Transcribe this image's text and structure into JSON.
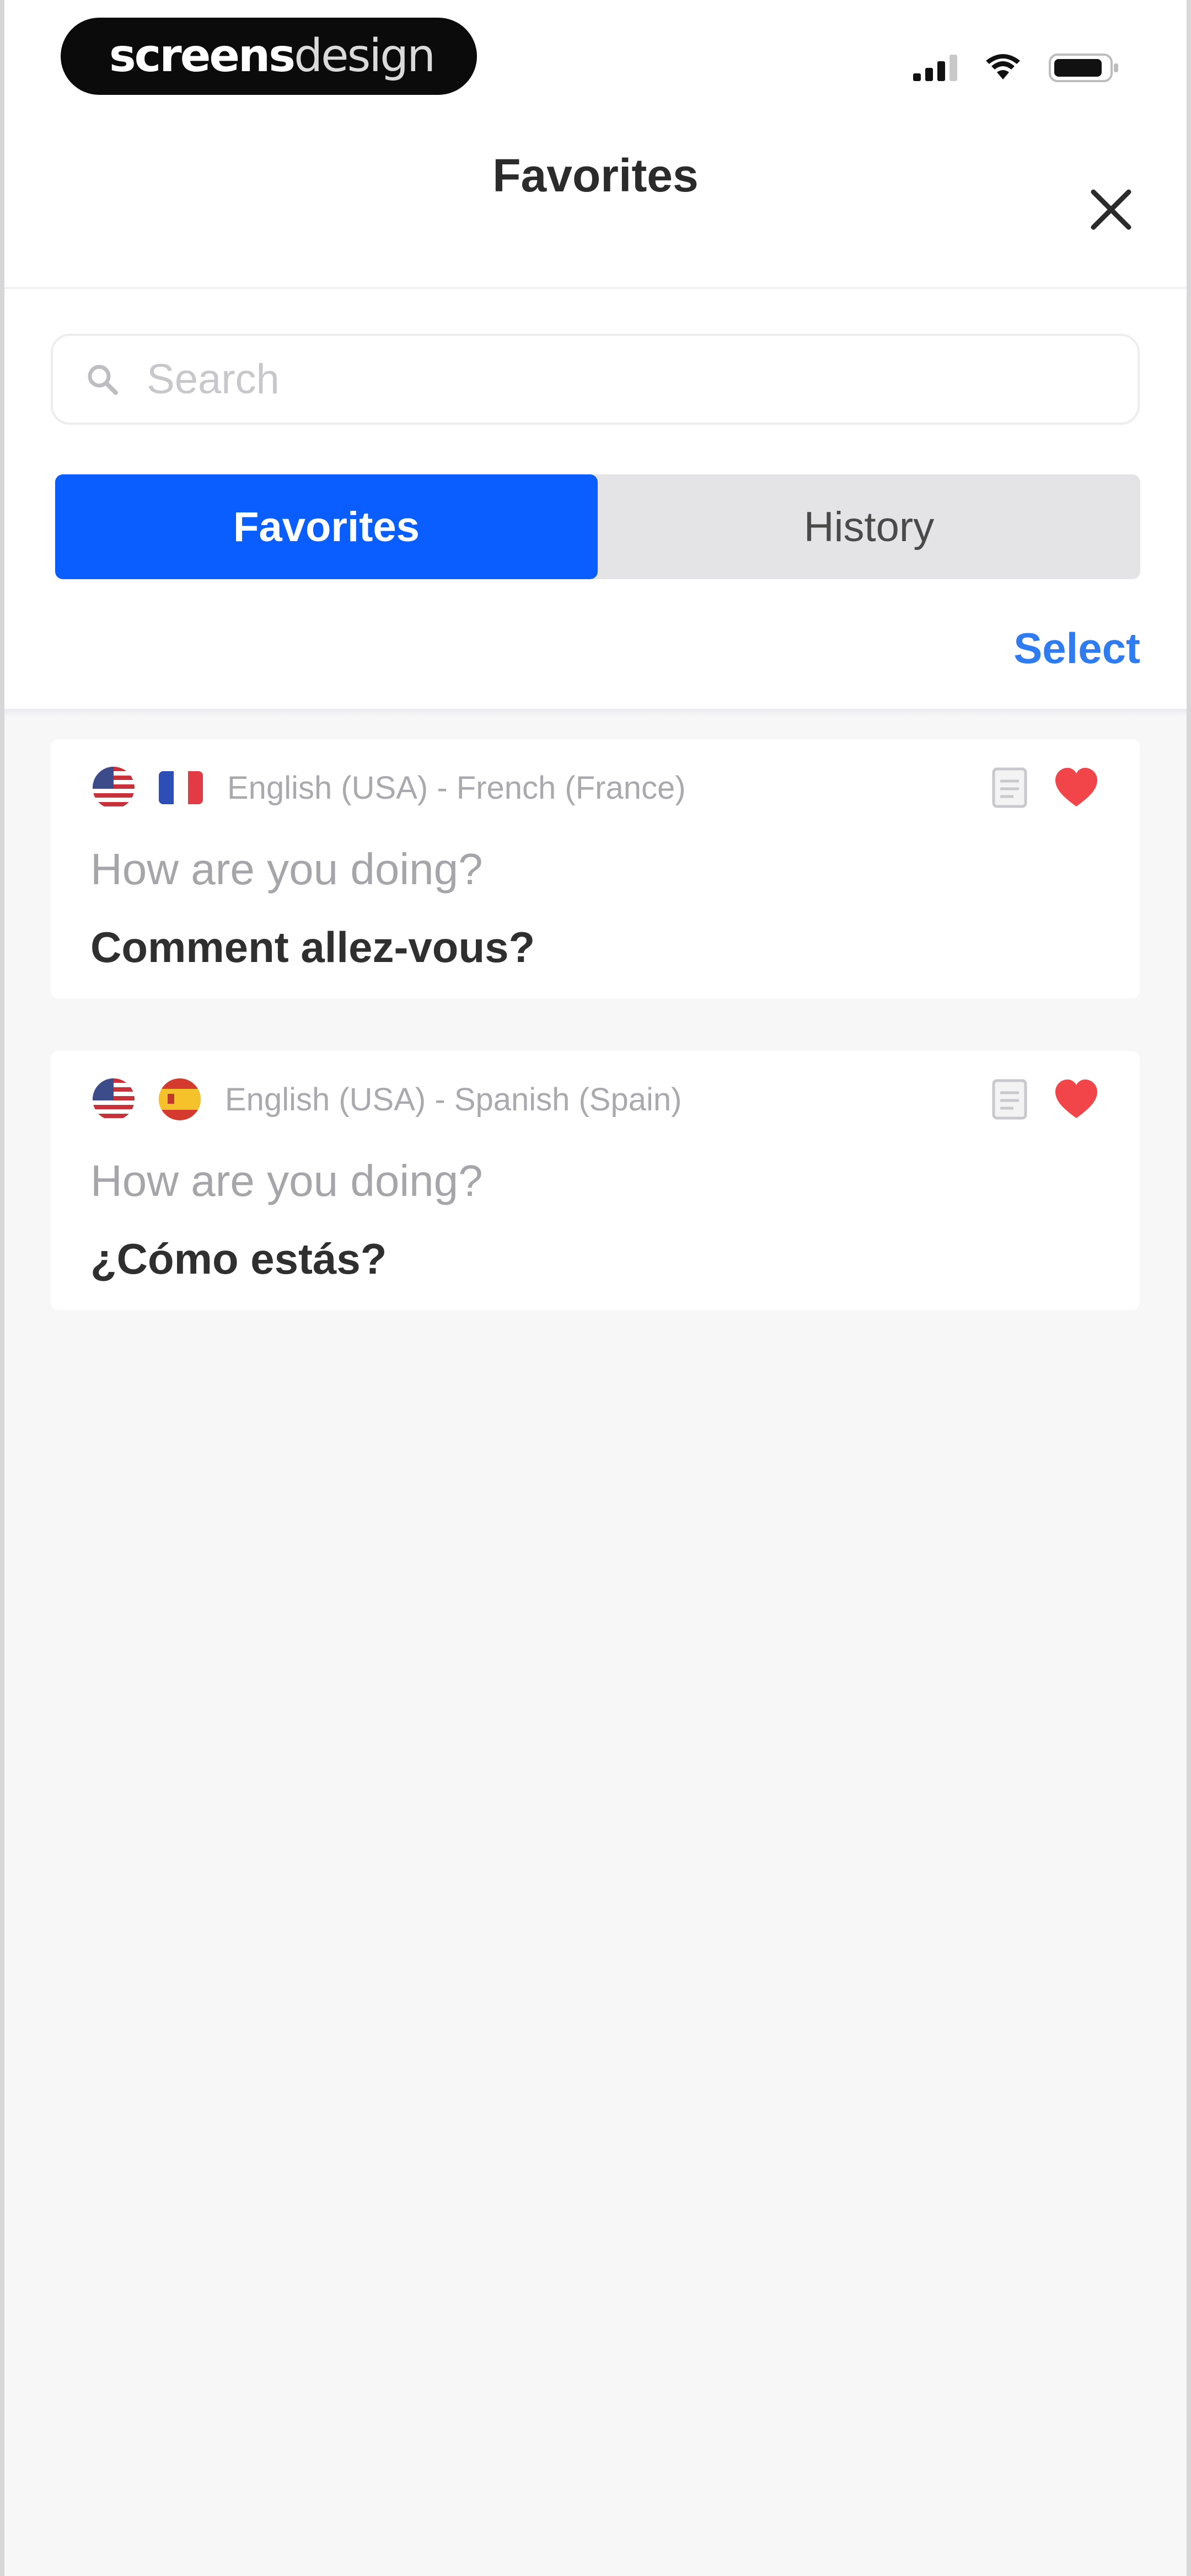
{
  "status_bar": {
    "watermark_bold": "screens",
    "watermark_light": "design"
  },
  "nav": {
    "title": "Favorites"
  },
  "search": {
    "placeholder": "Search",
    "value": ""
  },
  "tabs": [
    {
      "label": "Favorites",
      "active": true
    },
    {
      "label": "History",
      "active": false
    }
  ],
  "select_label": "Select",
  "cards": [
    {
      "language_pair": "English (USA) - French (France)",
      "source_flag": "us-flag-icon",
      "target_flag": "fr-flag-icon",
      "source_text": "How are you doing?",
      "translated_text": "Comment allez-vous?",
      "favorited": true
    },
    {
      "language_pair": "English (USA) - Spanish (Spain)",
      "source_flag": "us-flag-icon",
      "target_flag": "es-flag-icon",
      "source_text": "How are you doing?",
      "translated_text": "¿Cómo estás?",
      "favorited": true
    }
  ],
  "colors": {
    "accent": "#0a5eff",
    "link": "#2e7bf2",
    "heart": "#f1454a",
    "background": "#f7f7f8"
  }
}
